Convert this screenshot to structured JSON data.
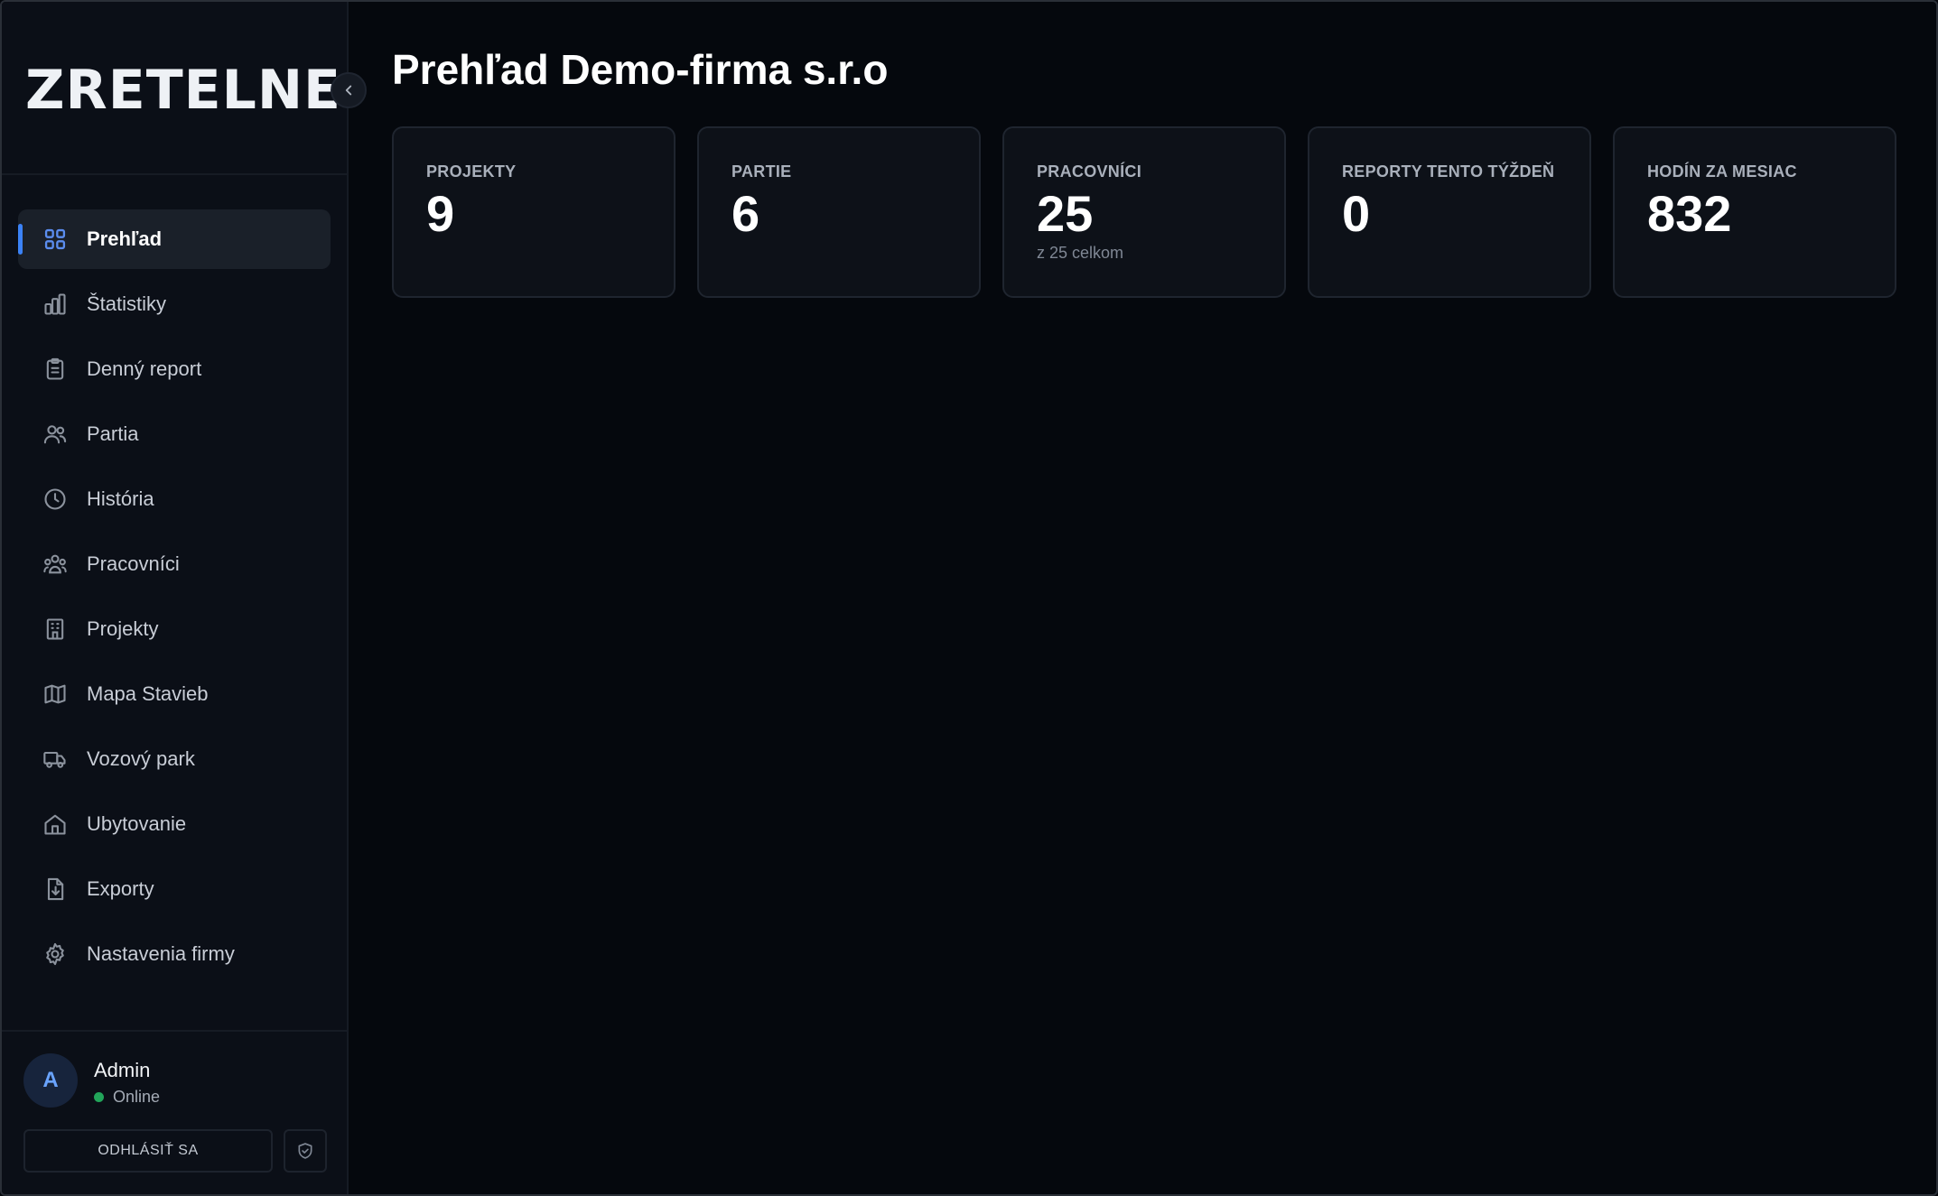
{
  "brand": {
    "logo_text": "ZRETELNE"
  },
  "sidebar": {
    "items": [
      {
        "label": "Prehľad",
        "icon": "grid-icon",
        "active": true
      },
      {
        "label": "Štatistiky",
        "icon": "bar-chart-icon"
      },
      {
        "label": "Denný report",
        "icon": "clipboard-icon"
      },
      {
        "label": "Partia",
        "icon": "users-icon"
      },
      {
        "label": "História",
        "icon": "clock-icon"
      },
      {
        "label": "Pracovníci",
        "icon": "team-icon"
      },
      {
        "label": "Projekty",
        "icon": "building-icon"
      },
      {
        "label": "Mapa Stavieb",
        "icon": "map-icon"
      },
      {
        "label": "Vozový park",
        "icon": "truck-icon"
      },
      {
        "label": "Ubytovanie",
        "icon": "home-icon"
      },
      {
        "label": "Exporty",
        "icon": "file-download-icon"
      },
      {
        "label": "Nastavenia firmy",
        "icon": "gear-icon"
      }
    ]
  },
  "user": {
    "initial": "A",
    "name": "Admin",
    "status": "Online",
    "status_color": "#22a55a",
    "logout_label": "ODHLÁSIŤ SA"
  },
  "main": {
    "title": "Prehľad Demo-firma s.r.o",
    "cards": [
      {
        "label": "PROJEKTY",
        "value": "9",
        "sub": ""
      },
      {
        "label": "PARTIE",
        "value": "6",
        "sub": ""
      },
      {
        "label": "PRACOVNÍCI",
        "value": "25",
        "sub": "z 25 celkom"
      },
      {
        "label": "REPORTY TENTO TÝŽDEŇ",
        "value": "0",
        "sub": ""
      },
      {
        "label": "HODÍN ZA MESIAC",
        "value": "832",
        "sub": ""
      }
    ]
  },
  "colors": {
    "accent": "#3b82f6",
    "background": "#05080d",
    "sidebar": "#0b0f17",
    "card": "#0d1118"
  }
}
